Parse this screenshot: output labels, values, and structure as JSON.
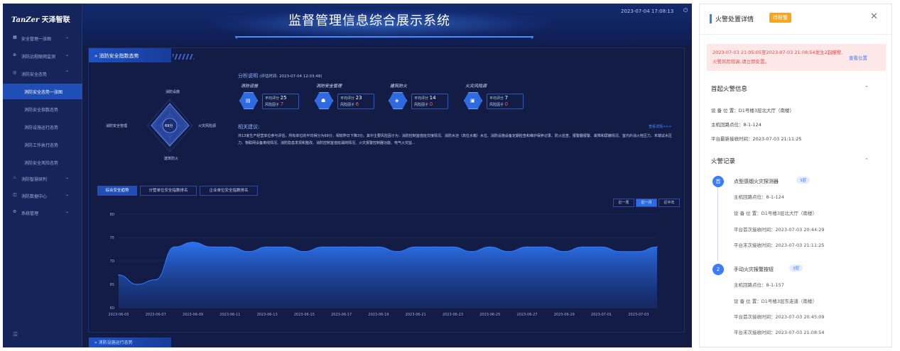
{
  "sidebar": {
    "logo_brand": "TanZer",
    "logo_name": "天泽智联",
    "items": [
      {
        "label": "安全管理一张图",
        "icon": "grid-icon",
        "expanded": false
      },
      {
        "label": "消防远程联网监测",
        "icon": "globe-icon",
        "expanded": false
      },
      {
        "label": "消防安全态势",
        "icon": "shield-icon",
        "expanded": true
      },
      {
        "label": "消防安全态势一张图",
        "sub": true,
        "active": true
      },
      {
        "label": "消防安全指数态势",
        "sub": true
      },
      {
        "label": "消防设施运行态势",
        "sub": true
      },
      {
        "label": "消防工作执行态势",
        "sub": true
      },
      {
        "label": "消防安全风险态势",
        "sub": true
      },
      {
        "label": "消防智慧研判",
        "icon": "flame-icon",
        "expanded": false
      },
      {
        "label": "消防数据中心",
        "icon": "database-icon",
        "expanded": false
      },
      {
        "label": "系统管理",
        "icon": "gear-icon",
        "expanded": false
      }
    ]
  },
  "header": {
    "title": "监督管理信息综合展示系统",
    "datetime": "2023-07-04 17:08:13"
  },
  "section": {
    "title": "» 消防安全指数态势",
    "next_title": "» 消防设施运行态势"
  },
  "radar": {
    "labels": [
      "消防设施",
      "火灾风险源",
      "建筑防火",
      "消防安全管理"
    ],
    "center_value": "69分"
  },
  "analysis": {
    "title": "分析说明",
    "eval_time": "(评估时间: 2023-07-04 12:03:48)",
    "metrics": [
      {
        "name": "消防设施",
        "avg_label": "平均评分",
        "avg": "25",
        "risk_label": "风险因子",
        "risk": "7"
      },
      {
        "name": "消防安全管理",
        "avg_label": "平均评分",
        "avg": "23",
        "risk_label": "风险因子",
        "risk": "6"
      },
      {
        "name": "建筑防火",
        "avg_label": "平均评分",
        "avg": "14",
        "risk_label": "风险因子",
        "risk": "0"
      },
      {
        "name": "火灾风险源",
        "avg_label": "平均评分",
        "avg": "7",
        "risk_label": "风险因子",
        "risk": "0"
      }
    ],
    "advice_title": "相关建议:",
    "more_link": "查看详情>>>",
    "advice_text": "共13家生产经营单位参与评估，所有单位的平均得分为69分，相较昨日下降3分。其中主要风险因子为：消防控制室值班交接情况、消防水池（高位水箱）水位、消防设施设备定期检查和维护保养记录、防火巡查、报警器报警、故障和屏蔽情况、室内外消火栓压力、末端试水压力、物联网设备离线情况、消防隐患发现和整改、消防控制室值班漏岗情况、火灾报警控制器功能、电气火灾监..."
  },
  "tabs": [
    {
      "label": "综合安全趋势",
      "active": true
    },
    {
      "label": "分管单位安全指数排名",
      "active": false
    },
    {
      "label": "企业单位安全指数排名",
      "active": false
    }
  ],
  "ranges": [
    {
      "label": "近一周",
      "active": false
    },
    {
      "label": "近一月",
      "active": true
    },
    {
      "label": "近半年",
      "active": false
    }
  ],
  "chart_data": {
    "type": "area",
    "x": [
      "2023-06-05",
      "2023-06-06",
      "2023-06-07",
      "2023-06-08",
      "2023-06-09",
      "2023-06-10",
      "2023-06-11",
      "2023-06-12",
      "2023-06-13",
      "2023-06-14",
      "2023-06-15",
      "2023-06-16",
      "2023-06-17",
      "2023-06-18",
      "2023-06-19",
      "2023-06-20",
      "2023-06-21",
      "2023-06-22",
      "2023-06-23",
      "2023-06-24",
      "2023-06-25",
      "2023-06-26",
      "2023-06-27",
      "2023-06-28",
      "2023-06-29",
      "2023-06-30",
      "2023-07-01",
      "2023-07-02",
      "2023-07-03",
      "2023-07-04"
    ],
    "x_tick_labels": [
      "2023-06-05",
      "2023-06-07",
      "2023-06-09",
      "2023-06-11",
      "2023-06-13",
      "2023-06-15",
      "2023-06-17",
      "2023-06-19",
      "2023-06-21",
      "2023-06-23",
      "2023-06-25",
      "2023-06-27",
      "2023-06-29",
      "2023-07-01",
      "2023-07-03"
    ],
    "values": [
      67,
      65,
      66,
      73,
      74,
      73,
      73,
      72,
      73,
      73,
      72,
      73,
      73,
      73,
      73,
      72,
      73,
      73,
      73,
      72,
      73,
      72,
      73,
      73,
      72,
      73,
      73,
      72,
      72,
      73
    ],
    "yticks": [
      60,
      65,
      70,
      75,
      80
    ],
    "ylim": [
      60,
      80
    ],
    "color": "#2f7bff"
  },
  "alarm": {
    "title": "火警处置详情",
    "badge": "待核警",
    "warning": "2023-07-03 21:05:05至2023-07-03 21:08:54发生2起报警,火警风险较高,请立即处置。",
    "view_location": "查看位置",
    "first_title": "首起火警信息",
    "device_location": "设 备 位 置：D1号楼3层北大厅（南楼）",
    "host_loop": "主机回路点位：8-1-124",
    "latest_time": "平台最新接收时间：2023-07-03 21:11:25",
    "records_title": "火警记录",
    "records": [
      {
        "step": "首",
        "name": "点型感烟火灾探测器",
        "floor": "3层",
        "host": "主机回路点位：8-1-124",
        "location": "设 备 位 置：D1号楼3层北大厅（南楼）",
        "first_recv": "平台首次接收时间：2023-07-03 20:44:29",
        "last_recv": "平台末次接收时间：2023-07-03 21:11:25"
      },
      {
        "step": "2",
        "name": "手动火灾报警按钮",
        "floor": "3层",
        "host": "主机回路点位：8-1-157",
        "location": "设 备 位 置：D1号楼3层东走道（南楼）",
        "first_recv": "平台首次接收时间：2023-07-03 20:45:09",
        "last_recv": "平台末次接收时间：2023-07-03 21:08:54"
      }
    ]
  }
}
